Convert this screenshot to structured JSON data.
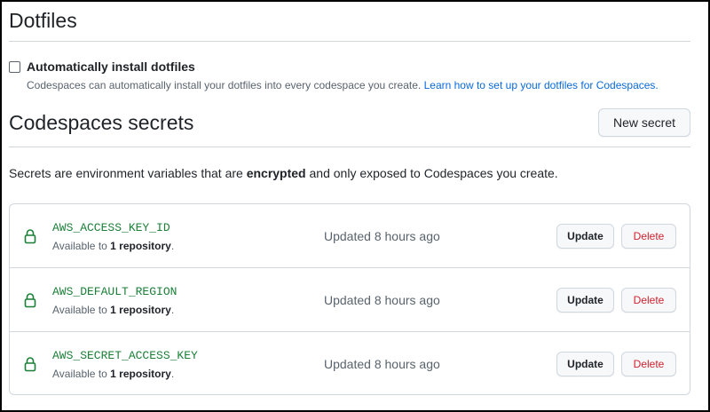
{
  "dotfiles": {
    "heading": "Dotfiles",
    "checkbox_label": "Automatically install dotfiles",
    "checked": false,
    "help_text": "Codespaces can automatically install your dotfiles into every codespace you create.",
    "help_link": "Learn how to set up your dotfiles for Codespaces."
  },
  "secrets": {
    "heading": "Codespaces secrets",
    "new_button": "New secret",
    "desc_prefix": "Secrets are environment variables that are ",
    "desc_bold": "encrypted",
    "desc_suffix": " and only exposed to Codespaces you create.",
    "items": [
      {
        "name": "AWS_ACCESS_KEY_ID",
        "available_prefix": "Available to ",
        "available_count": "1 repository",
        "available_suffix": ".",
        "updated": "Updated 8 hours ago",
        "update_label": "Update",
        "delete_label": "Delete"
      },
      {
        "name": "AWS_DEFAULT_REGION",
        "available_prefix": "Available to ",
        "available_count": "1 repository",
        "available_suffix": ".",
        "updated": "Updated 8 hours ago",
        "update_label": "Update",
        "delete_label": "Delete"
      },
      {
        "name": "AWS_SECRET_ACCESS_KEY",
        "available_prefix": "Available to ",
        "available_count": "1 repository",
        "available_suffix": ".",
        "updated": "Updated 8 hours ago",
        "update_label": "Update",
        "delete_label": "Delete"
      }
    ]
  },
  "colors": {
    "accent_link": "#0969da",
    "secret_green": "#1a7f37",
    "danger": "#cf222e",
    "border": "#d0d7de",
    "muted": "#59636e"
  },
  "icons": {
    "lock": "lock-icon"
  }
}
